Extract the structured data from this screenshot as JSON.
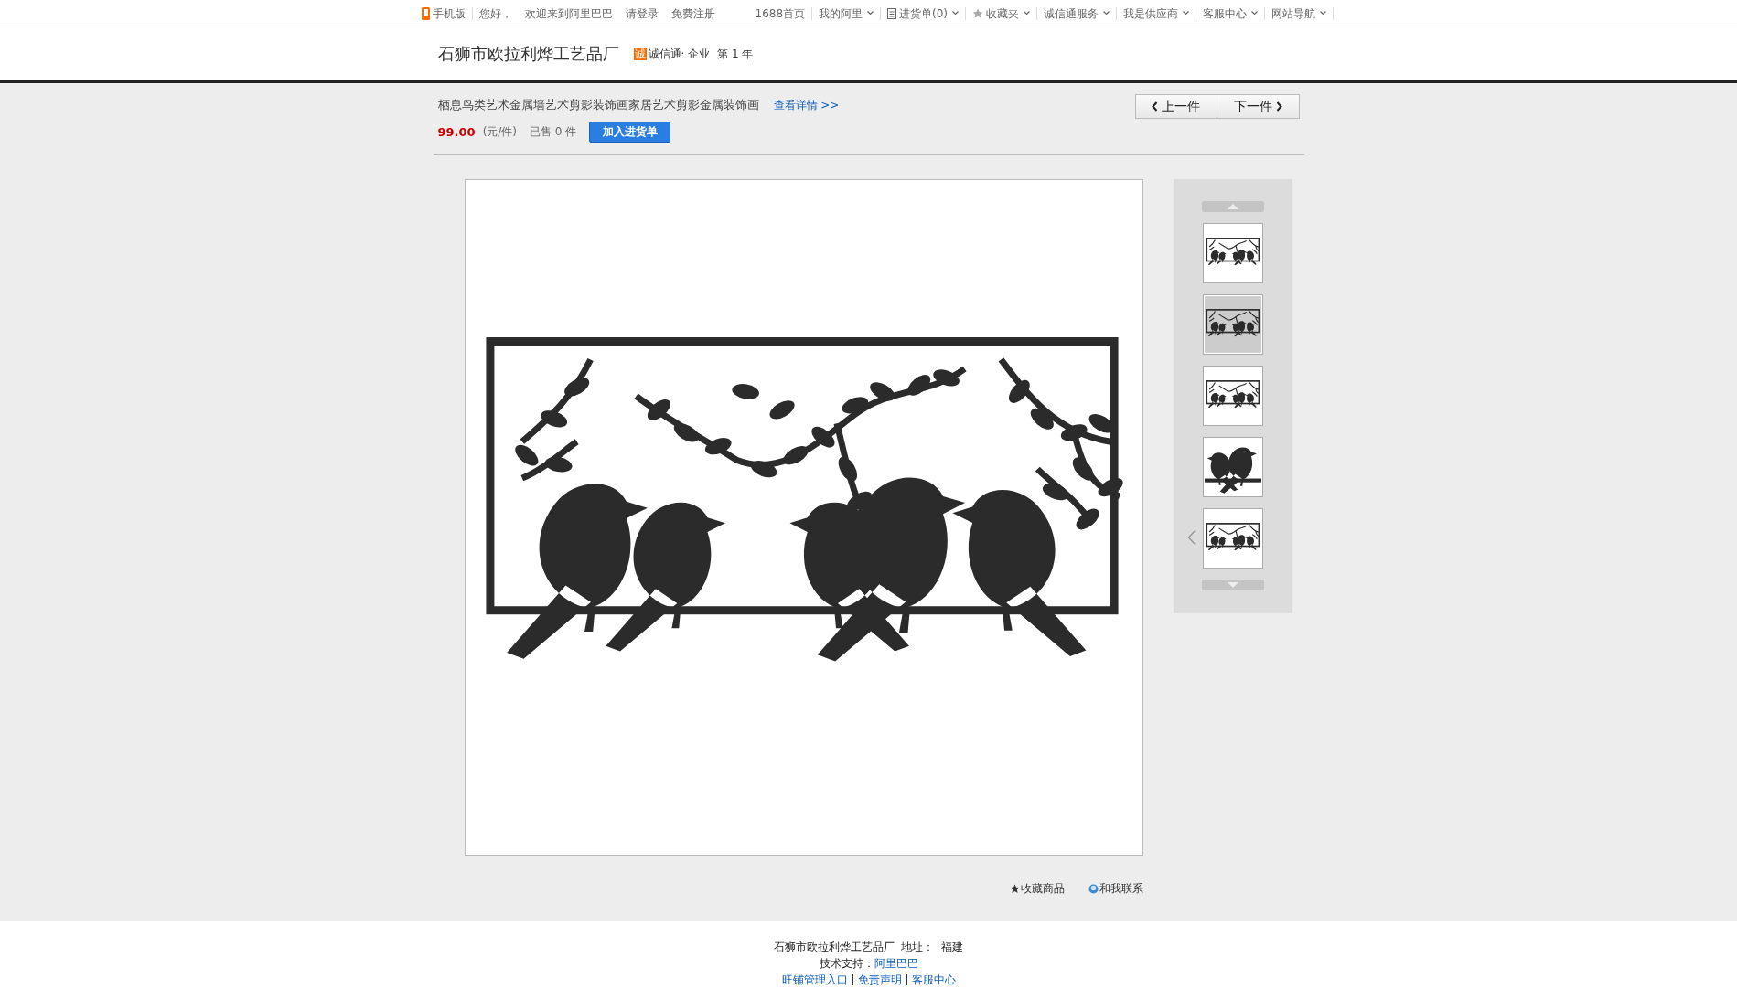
{
  "top_bar": {
    "left": [
      {
        "label": "手机版",
        "kind": "phone"
      },
      {
        "label": "您好，",
        "kind": "plain"
      },
      {
        "label": "欢迎来到阿里巴巴",
        "kind": "plain"
      },
      {
        "label": "请登录",
        "kind": "plain"
      },
      {
        "label": "免费注册",
        "kind": "plain"
      }
    ],
    "right": [
      {
        "label": "1688首页",
        "kind": "plain",
        "has_menu": false
      },
      {
        "label": "我的阿里",
        "kind": "plain",
        "has_menu": true
      },
      {
        "label": "进货单(0)",
        "kind": "list",
        "has_menu": true
      },
      {
        "label": "收藏夹",
        "kind": "star",
        "has_menu": true
      },
      {
        "label": "诚信通服务",
        "kind": "plain",
        "has_menu": true
      },
      {
        "label": "我是供应商",
        "kind": "plain",
        "has_menu": true
      },
      {
        "label": "客服中心",
        "kind": "plain",
        "has_menu": true
      },
      {
        "label": "网站导航",
        "kind": "plain",
        "has_menu": true
      }
    ]
  },
  "header": {
    "company": "石狮市欧拉利烨工艺品厂",
    "badge_mark": "诚",
    "membership": "诚信通· 企业",
    "years": "第 1 年"
  },
  "product": {
    "title": "栖息鸟类艺术金属墙艺术剪影装饰画家居艺术剪影金属装饰画",
    "detail_link": "查看详情 >>",
    "price": "99.00",
    "unit": "(元/件)",
    "sold": "已售 0 件",
    "add_button": "加入进货单",
    "prev": "上一件",
    "next": "下一件"
  },
  "actions": [
    {
      "label": "收藏商品",
      "kind": "star"
    },
    {
      "label": "和我联系",
      "kind": "chat"
    }
  ],
  "footer": {
    "address": "石狮市欧拉利烨工艺品厂  地址：  福建",
    "support_label": "技术支持：",
    "support_link": "阿里巴巴",
    "links": [
      "旺铺管理入口",
      "免责声明",
      "客服中心"
    ]
  }
}
